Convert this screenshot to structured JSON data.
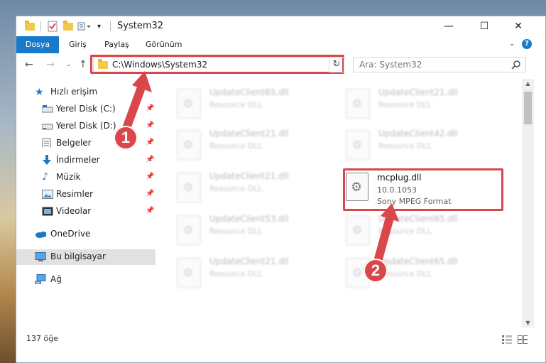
{
  "window": {
    "title": "System32",
    "controls": {
      "minimize": "—",
      "maximize": "☐",
      "close": "✕"
    }
  },
  "ribbon": {
    "tabs": [
      {
        "label": "Dosya"
      },
      {
        "label": "Giriş"
      },
      {
        "label": "Paylaş"
      },
      {
        "label": "Görünüm"
      }
    ],
    "help": "?"
  },
  "nav": {
    "address_path": "C:\\Windows\\System32",
    "search_placeholder": "Ara: System32"
  },
  "sidebar": {
    "items": [
      {
        "label": "Hızlı erişim",
        "icon": "star-icon"
      },
      {
        "label": "Yerel Disk (C:)",
        "icon": "disk-icon",
        "pinned": true
      },
      {
        "label": "Yerel Disk (D:)",
        "icon": "disk-icon",
        "pinned": true
      },
      {
        "label": "Belgeler",
        "icon": "documents-icon",
        "pinned": true
      },
      {
        "label": "İndirmeler",
        "icon": "download-icon",
        "pinned": true
      },
      {
        "label": "Müzik",
        "icon": "music-icon",
        "pinned": true
      },
      {
        "label": "Resimler",
        "icon": "pictures-icon",
        "pinned": true
      },
      {
        "label": "Videolar",
        "icon": "video-icon",
        "pinned": true
      },
      {
        "label": "OneDrive",
        "icon": "cloud-icon"
      },
      {
        "label": "Bu bilgisayar",
        "icon": "computer-icon",
        "selected": true
      },
      {
        "label": "Ağ",
        "icon": "network-icon"
      }
    ]
  },
  "files": [
    {
      "name": "UpdateClient65.dll",
      "desc": "Resource DLL"
    },
    {
      "name": "UpdateClient21.dll",
      "desc": "Resource DLL"
    },
    {
      "name": "UpdateClient21.dll",
      "desc": "Resource DLL"
    },
    {
      "name": "UpdateClient42.dll",
      "desc": "Resource DLL"
    },
    {
      "name": "UpdateClient21.dll",
      "desc": "Resource DLL"
    },
    {
      "name": "UpdateClient53.dll",
      "desc": "Resource DLL"
    },
    {
      "name": "UpdateClient65.dll",
      "desc": "Resource DLL"
    },
    {
      "name": "UpdateClient21.dll",
      "desc": "Resource DLL"
    },
    {
      "name": "UpdateClient65.dll",
      "desc": "Resource DLL"
    }
  ],
  "highlighted_file": {
    "name": "mcplug.dll",
    "version": "10.0.1053",
    "desc": "Sony MPEG Format"
  },
  "status": {
    "count": "137 öğe"
  },
  "annotations": {
    "step1": "1",
    "step2": "2"
  },
  "colors": {
    "accent": "#1979ca",
    "highlight": "#d9474b"
  }
}
